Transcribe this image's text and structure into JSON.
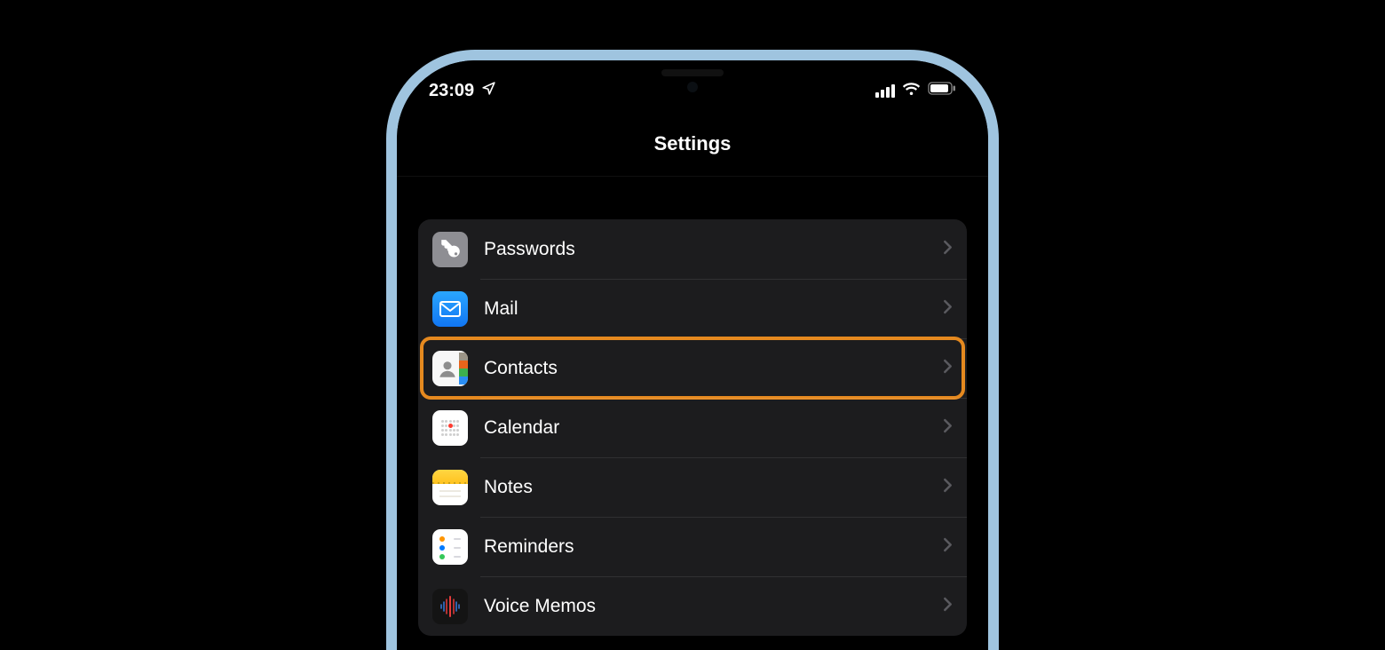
{
  "status": {
    "time": "23:09"
  },
  "nav": {
    "title": "Settings"
  },
  "group": {
    "items": [
      {
        "label": "Passwords",
        "icon": "key-icon"
      },
      {
        "label": "Mail",
        "icon": "mail-icon"
      },
      {
        "label": "Contacts",
        "icon": "contacts-icon",
        "highlighted": true
      },
      {
        "label": "Calendar",
        "icon": "calendar-icon"
      },
      {
        "label": "Notes",
        "icon": "notes-icon"
      },
      {
        "label": "Reminders",
        "icon": "reminders-icon"
      },
      {
        "label": "Voice Memos",
        "icon": "voice-memos-icon"
      }
    ]
  },
  "annotation": {
    "highlight_color": "#e5891f"
  }
}
